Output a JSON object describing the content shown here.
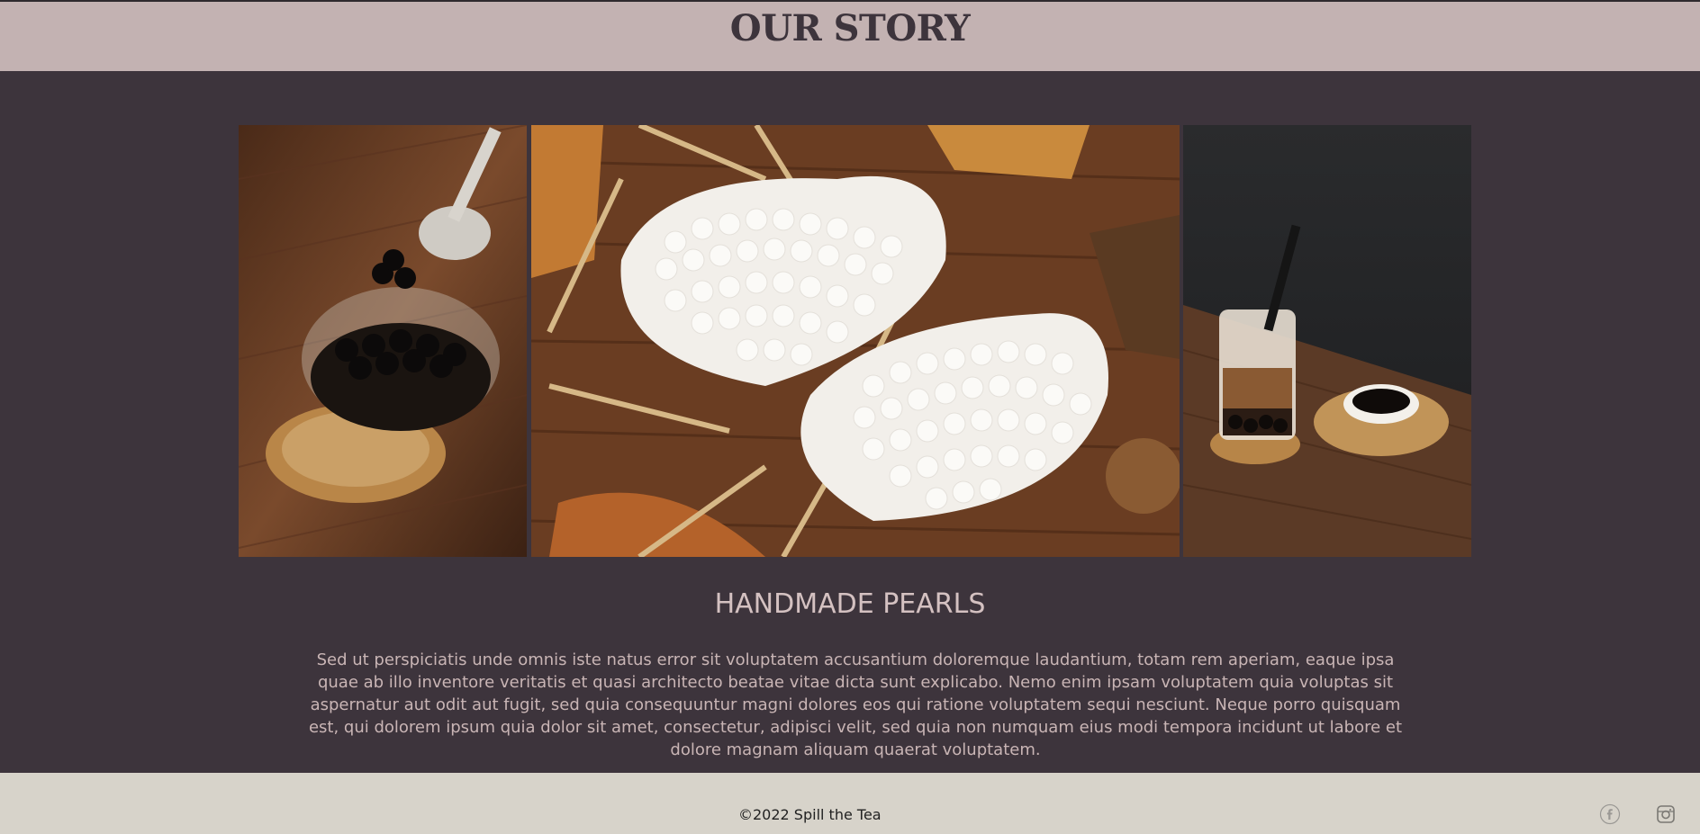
{
  "header": {
    "title": "OUR STORY"
  },
  "gallery": {
    "images": [
      {
        "alt": "tapioca-pearls-bowl-spoon"
      },
      {
        "alt": "white-tapioca-pearls-dishes"
      },
      {
        "alt": "bubble-tea-glass"
      }
    ]
  },
  "section": {
    "title": "HANDMADE PEARLS",
    "body": "Sed ut perspiciatis unde omnis iste natus error sit voluptatem accusantium doloremque laudantium, totam rem aperiam, eaque ipsa quae ab illo inventore veritatis et quasi architecto beatae vitae dicta sunt explicabo. Nemo enim ipsam voluptatem quia voluptas sit aspernatur aut odit aut fugit, sed quia consequuntur magni dolores eos qui ratione voluptatem sequi nesciunt. Neque porro quisquam est, qui dolorem ipsum quia dolor sit amet, consectetur, adipisci velit, sed quia non numquam eius modi tempora incidunt ut labore et dolore magnam aliquam quaerat voluptatem."
  },
  "footer": {
    "copyright": "©2022 Spill the Tea",
    "social": [
      {
        "icon": "facebook-icon"
      },
      {
        "icon": "instagram-icon"
      }
    ]
  },
  "colors": {
    "header_bg": "#c3b2b2",
    "page_bg": "#3d343c",
    "footer_bg": "#d7d3ca",
    "heading_text": "#d4c1c1"
  }
}
